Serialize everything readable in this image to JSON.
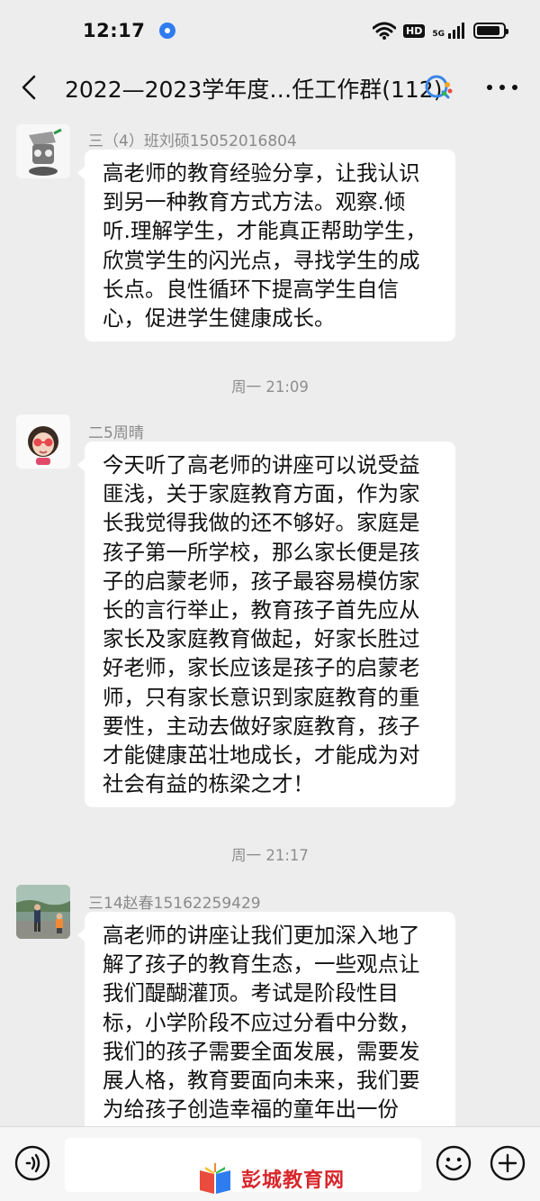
{
  "status_bar": {
    "time": "12:17",
    "hd_label": "HD",
    "network_label": "5G",
    "battery_level": 0.9
  },
  "header": {
    "title": "2022—2023学年度…任工作群(112)"
  },
  "timeline": [
    {
      "kind": "message",
      "sender": "三（4）班刘硕15052016804",
      "avatar_icon": "cartoon-avatar-icon",
      "lines": [
        "高老师的教育经验分享，让我认识",
        "到另一种教育方式方法。观察.倾",
        "听.理解学生，才能真正帮助学生，",
        "欣赏学生的闪光点，寻找学生的成",
        "长点。良性循环下提高学生自信",
        "心，促进学生健康成长。"
      ]
    },
    {
      "kind": "time",
      "text": "周一 21:09"
    },
    {
      "kind": "message",
      "sender": "二5周晴",
      "avatar_icon": "girl-sunglasses-avatar-icon",
      "lines": [
        "今天听了高老师的讲座可以说受益",
        "匪浅，关于家庭教育方面，作为家",
        "长我觉得我做的还不够好。家庭是",
        "孩子第一所学校，那么家长便是孩",
        "子的启蒙老师，孩子最容易模仿家",
        "长的言行举止，教育孩子首先应从",
        "家长及家庭教育做起，好家长胜过",
        "好老师，家长应该是孩子的启蒙老",
        "师，只有家长意识到家庭教育的重",
        "要性，主动去做好家庭教育，孩子",
        "才能健康茁壮地成长，才能成为对",
        "社会有益的栋梁之才！"
      ]
    },
    {
      "kind": "time",
      "text": "周一 21:17"
    },
    {
      "kind": "message",
      "sender": "三14赵春15162259429",
      "avatar_icon": "children-lakeside-avatar-icon",
      "lines": [
        "高老师的讲座让我们更加深入地了",
        "解了孩子的教育生态，一些观点让",
        "我们醍醐灌顶。考试是阶段性目",
        "标，小学阶段不应过分看中分数，",
        "我们的孩子需要全面发展，需要发",
        "展人格，教育要面向未来，我们要",
        "为给孩子创造幸福的童年出一份"
      ]
    }
  ],
  "input_bar": {
    "voice_icon": "voice-icon",
    "emoji_icon": "emoji-icon",
    "plus_icon": "plus-icon"
  },
  "watermark": {
    "text": "彭城教育网",
    "logo_icon": "book-logo-icon"
  },
  "colors": {
    "background": "#ededed",
    "bubble": "#ffffff",
    "watermark_red": "#d8262b",
    "accent_blue": "#2f7cf0"
  }
}
